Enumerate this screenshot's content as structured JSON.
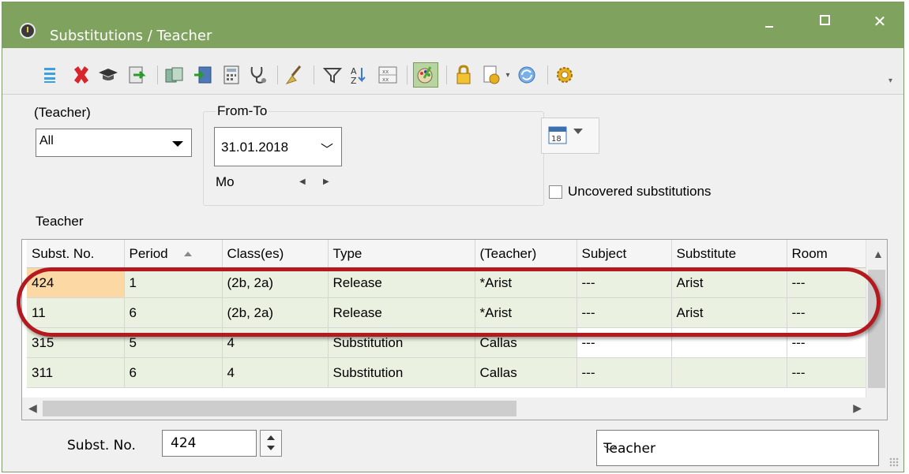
{
  "window": {
    "title": "Substitutions / Teacher",
    "min_label": "–",
    "max_label": "□",
    "close_label": "✕"
  },
  "toolbar": {
    "icons": [
      "list-icon",
      "delete-icon",
      "graduation-cap-icon",
      "import-icon",
      "notes-icon",
      "export-icon",
      "calculator-icon",
      "stethoscope-icon",
      "broom-icon",
      "filter-icon",
      "sort-icon",
      "grid-icon",
      "palette-icon",
      "lock-icon",
      "document-settings-icon",
      "refresh-icon",
      "gear-icon"
    ],
    "more_label": "▾"
  },
  "filters": {
    "teacher_label": "(Teacher)",
    "teacher_value": "All",
    "fromto_label": "From-To",
    "date_value": "31.01.2018",
    "day_label": "Mo",
    "uncovered_label": "Uncovered substitutions",
    "section_label": "Teacher"
  },
  "table": {
    "headers": [
      "Subst. No.",
      "Period",
      "Class(es)",
      "Type",
      "(Teacher)",
      "Subject",
      "Substitute",
      "Room"
    ],
    "rows": [
      [
        "424",
        "1",
        "(2b, 2a)",
        "Release",
        "*Arist",
        "---",
        "Arist",
        "---"
      ],
      [
        "11",
        "6",
        "(2b, 2a)",
        "Release",
        "*Arist",
        "---",
        "Arist",
        "---"
      ],
      [
        "315",
        "5",
        "4",
        "Substitution",
        "Callas",
        "---",
        "",
        "---"
      ],
      [
        "311",
        "6",
        "4",
        "Substitution",
        "Callas",
        "---",
        "",
        "---"
      ]
    ]
  },
  "footer": {
    "subst_label": "Subst. No.",
    "subst_value": "424",
    "view_value": "Teacher"
  },
  "colors": {
    "titlebar": "#7fa35e",
    "row_bg": "#eaf1e1",
    "selected_cell": "#fcd9a4",
    "highlight_ellipse": "#b3191e"
  }
}
